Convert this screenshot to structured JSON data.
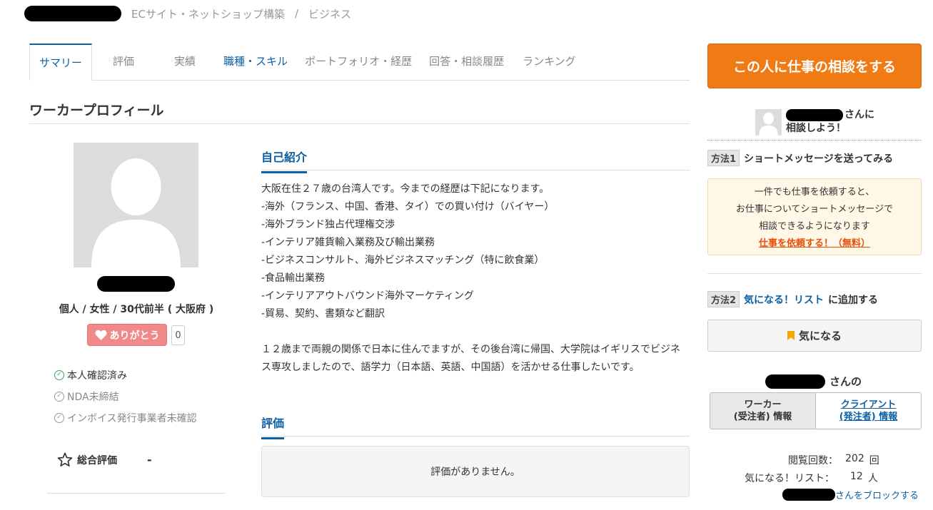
{
  "breadcrumb": {
    "category": "ECサイト・ネットショップ構築",
    "separator": "/",
    "parent": "ビジネス"
  },
  "tabs": [
    {
      "label": "サマリー",
      "state": "active"
    },
    {
      "label": "評価",
      "state": "muted"
    },
    {
      "label": "実績",
      "state": "muted"
    },
    {
      "label": "職種・スキル",
      "state": "link"
    },
    {
      "label": "ポートフォリオ・経歴",
      "state": "muted"
    },
    {
      "label": "回答・相談履歴",
      "state": "muted"
    },
    {
      "label": "ランキング",
      "state": "muted"
    }
  ],
  "page_title": "ワーカープロフィール",
  "profile": {
    "meta": "個人 / 女性 / 30代前半 ( 大阪府 )",
    "thanks_label": "ありがとう",
    "thanks_count": "0",
    "badges": [
      {
        "label": "本人確認済み",
        "verified": true
      },
      {
        "label": "NDA未締結",
        "verified": false
      },
      {
        "label": "インボイス発行事業者未確認",
        "verified": false
      }
    ],
    "rating_label": "総合評価",
    "rating_value": "-"
  },
  "intro": {
    "heading": "自己紹介",
    "lines": [
      "大阪在住２７歳の台湾人です。今までの経歴は下記になります。",
      "-海外（フランス、中国、香港、タイ）での買い付け（バイヤー）",
      "-海外ブランド独占代理権交渉",
      "-インテリア雑貨輸入業務及び輸出業務",
      "-ビジネスコンサルト、海外ビジネスマッチング（特に飲食業）",
      "-食品輸出業務",
      "-インテリアアウトバウンド海外マーケティング",
      "-貿易、契約、書類など翻訳"
    ],
    "paragraph2": "１２歳まで両親の関係で日本に住んでますが、その後台湾に帰国、大学院はイギリスでビジネス専攻しましたので、語学力（日本語、英語、中国語）を活かせる仕事したいです。"
  },
  "reviews": {
    "heading": "評価",
    "empty": "評価がありません。"
  },
  "sidebar": {
    "consult_button": "この人に仕事の相談をする",
    "lead_suffix": "さんに",
    "lead_line2": "相談しよう！",
    "method1_tag": "方法1",
    "method1_text": "ショートメッセージを送ってみる",
    "notice_lines": [
      "一件でも仕事を依頼すると、",
      "お仕事についてショートメッセージで",
      "相談できるようになります"
    ],
    "notice_cta": "仕事を依頼する！（無料）",
    "method2_tag": "方法2",
    "method2_link": "気になる！リスト",
    "method2_suffix": "に追加する",
    "fav_button": "気になる",
    "owner_suffix": "さんの",
    "role_worker_1": "ワーカー",
    "role_worker_2": "(受注者) 情報",
    "role_client_1": "クライアント",
    "role_client_2": "(発注者) 情報",
    "views_label": "閲覧回数：",
    "views_value": "202",
    "views_unit": "回",
    "fav_label": "気になる！リスト：",
    "fav_value": "12",
    "fav_unit": "人",
    "block_link": "さんをブロックする"
  },
  "colors": {
    "accent_blue": "#0b5fa5",
    "cta_orange": "#f07a14",
    "thanks_pink": "#f08a8a",
    "verified_green": "#3aa55a"
  }
}
